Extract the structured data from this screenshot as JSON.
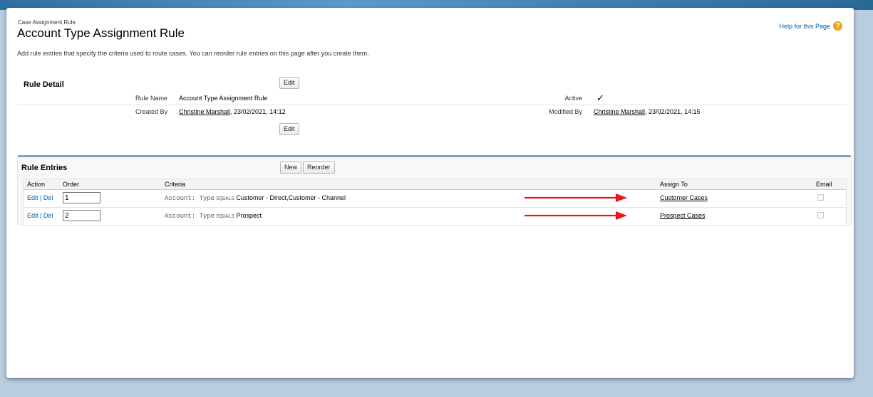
{
  "header": {
    "page_type": "Case Assignment Rule",
    "title": "Account Type Assignment Rule",
    "help_label": "Help for this Page",
    "help_icon": "help-icon",
    "intro": "Add rule entries that specify the criteria used to route cases. You can reorder rule entries on this page after you create them."
  },
  "rule_detail": {
    "title": "Rule Detail",
    "edit_label": "Edit",
    "fields": {
      "rule_name_label": "Rule Name",
      "rule_name_value": "Account Type Assignment Rule",
      "active_label": "Active",
      "active_mark": "✓",
      "created_by_label": "Created By",
      "created_by_user": "Christine Marshall",
      "created_by_date": ", 23/02/2021, 14:12",
      "modified_by_label": "Modified By",
      "modified_by_user": "Christine Marshall",
      "modified_by_date": ", 23/02/2021, 14:15"
    }
  },
  "rule_entries": {
    "title": "Rule Entries",
    "new_label": "New",
    "reorder_label": "Reorder",
    "columns": [
      "Action",
      "Order",
      "Criteria",
      "Assign To",
      "Email"
    ],
    "rows": [
      {
        "edit": "Edit",
        "sep": "|",
        "del": "Del",
        "order": "1",
        "criteria_field": "Account: Type",
        "criteria_op": "EQUALS",
        "criteria_value": "Customer - Direct,Customer - Channel",
        "assign_to": "Customer Cases",
        "email_checked": false
      },
      {
        "edit": "Edit",
        "sep": "|",
        "del": "Del",
        "order": "2",
        "criteria_field": "Account: Type",
        "criteria_op": "EQUALS",
        "criteria_value": "Prospect",
        "assign_to": "Prospect Cases",
        "email_checked": false
      }
    ]
  },
  "colors": {
    "link": "#015ba7",
    "arrow": "#e8161b",
    "help_icon": "#e8a31d"
  }
}
